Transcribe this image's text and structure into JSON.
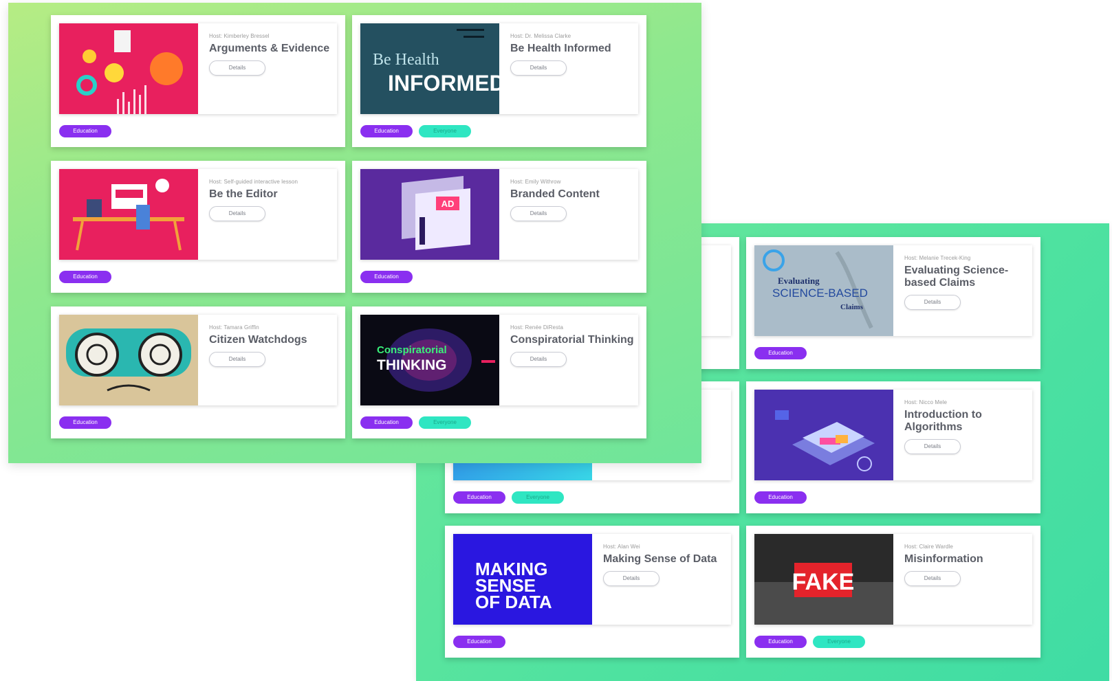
{
  "colors": {
    "tag_education": "#8a2ff0",
    "tag_everyone": "#2fe6c2",
    "panel_front_gradient": [
      "#b6ec84",
      "#6fe59a"
    ],
    "panel_back_gradient": [
      "#6fe89a",
      "#3fdca4"
    ]
  },
  "front_panel": {
    "cards": [
      {
        "host": "Host: Kimberley Bressel",
        "title": "Arguments & Evidence",
        "details": "Details",
        "tags": [
          "Education"
        ]
      },
      {
        "host": "Host: Dr. Melissa Clarke",
        "title": "Be Health Informed",
        "details": "Details",
        "tags": [
          "Education",
          "Everyone"
        ],
        "thumb_text": [
          "Be Health",
          "INFORMED"
        ]
      },
      {
        "host": "Host: Self-guided interactive lesson",
        "title": "Be the Editor",
        "details": "Details",
        "tags": [
          "Education"
        ]
      },
      {
        "host": "Host: Emily Withrow",
        "title": "Branded Content",
        "details": "Details",
        "tags": [
          "Education"
        ],
        "thumb_text": [
          "AD"
        ]
      },
      {
        "host": "Host: Tamara Griffin",
        "title": "Citizen Watchdogs",
        "details": "Details",
        "tags": [
          "Education"
        ]
      },
      {
        "host": "Host: Renée DiResta",
        "title": "Conspiratorial Thinking",
        "details": "Details",
        "tags": [
          "Education",
          "Everyone"
        ],
        "thumb_text": [
          "Conspiratorial",
          "THINKING"
        ]
      }
    ]
  },
  "back_panel": {
    "cards": [
      {
        "host": "Host: Melanie Trecek-King",
        "title": "Evaluating Science-based Claims",
        "details": "Details",
        "tags": [
          "Education"
        ],
        "thumb_text": [
          "Evaluating",
          "SCIENCE-BASED",
          "Claims"
        ]
      },
      {
        "host": "Host: Nicco Mele",
        "title": "Introduction to Algorithms",
        "details": "Details",
        "tags": [
          "Education"
        ]
      },
      {
        "host": "Host: Alan Wei",
        "title": "Making Sense of Data",
        "details": "Details",
        "tags": [
          "Education"
        ],
        "thumb_text": [
          "MAKING",
          "SENSE",
          "OF DATA"
        ]
      },
      {
        "host": "Host: Claire Wardle",
        "title": "Misinformation",
        "details": "Details",
        "tags": [
          "Education",
          "Everyone"
        ],
        "thumb_text": [
          "FAKE"
        ]
      }
    ],
    "partial_tags": [
      "Education",
      "Everyone"
    ]
  }
}
